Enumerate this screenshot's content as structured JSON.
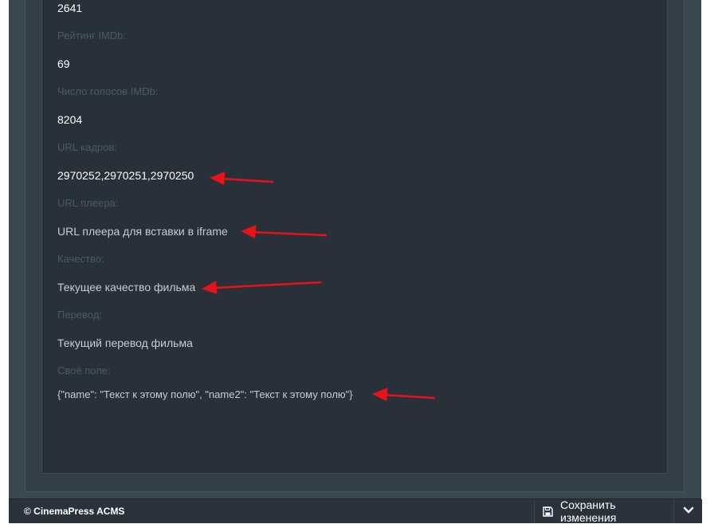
{
  "fields": [
    {
      "label": "",
      "value": "2641"
    },
    {
      "label": "Рейтинг IMDb:",
      "value": "69"
    },
    {
      "label": "Число голосов IMDb:",
      "value": "8204"
    },
    {
      "label": "URL кадров:",
      "value": "2970252,2970251,2970250"
    },
    {
      "label": "URL плеера:",
      "value": "URL плеера для вставки в iframe"
    },
    {
      "label": "Качество:",
      "value": "Текущее качество фильма"
    },
    {
      "label": "Перевод:",
      "value": "Текущий перевод фильма"
    },
    {
      "label": "Своё поле:",
      "value": "{\"name\": \"Текст к этому полю\", \"name2\": \"Текст к этому полю\"}"
    }
  ],
  "footer": {
    "copyright": "© CinemaPress ACMS",
    "save_label": "Сохранить изменения",
    "save_icon": "floppy-disk-icon",
    "expand_icon": "chevron-down-icon"
  },
  "colors": {
    "panel_bg": "#28303a",
    "label_text": "#4b5a67",
    "value_text": "#ffffff",
    "annotation_arrow": "#e8121a"
  }
}
